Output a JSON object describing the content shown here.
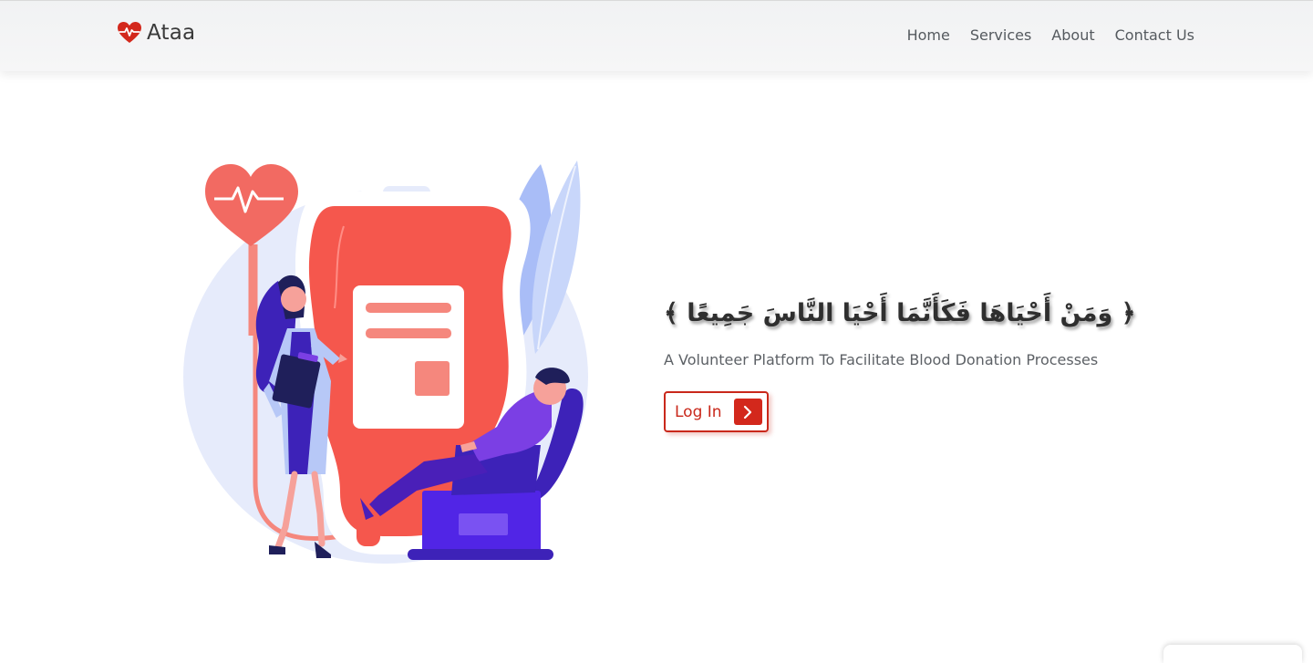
{
  "brand": {
    "name": "Ataa",
    "icon": "heart-pulse-icon",
    "accent_color": "#d3281c"
  },
  "nav": {
    "items": [
      {
        "label": "Home"
      },
      {
        "label": "Services"
      },
      {
        "label": "About"
      },
      {
        "label": "Contact Us"
      }
    ]
  },
  "hero": {
    "verse": "﴿ وَمَنْ أَحْيَاهَا فَكَأَنَّمَا أَحْيَا النَّاسَ جَمِيعًا ﴾",
    "tagline": "A Volunteer Platform To Facilitate Blood Donation Processes",
    "login_label": "Log In",
    "login_icon": "chevron-right-icon",
    "illustration": "blood-donation-illustration"
  }
}
